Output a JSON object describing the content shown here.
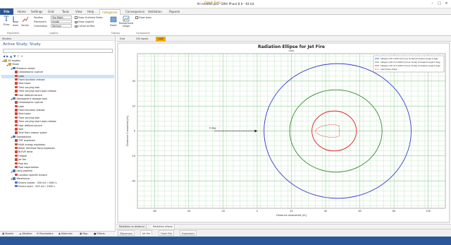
{
  "window": {
    "title": "All models.psu - DNV Phast 8.9 - 64 bit",
    "context_label": "Graph Tools"
  },
  "ribbon_tabs": [
    "File",
    "Home",
    "Settings",
    "Grid",
    "Tools",
    "View",
    "Help",
    "Categories",
    "Consequence",
    "Validation",
    "Reports"
  ],
  "ribbon": {
    "groups": [
      "Properties",
      "Legend",
      "Display",
      "Component"
    ],
    "buttons": {
      "titles": "Titles",
      "axes": "Axes",
      "series": "Series",
      "reset": "Reset",
      "background": "Background image",
      "component": "Show Axes"
    },
    "position_label": "Position",
    "position_value": "Top Right",
    "placement_label": "Placement",
    "placement_value": "Inside",
    "orientation_label": "Orientation",
    "orientation_value": "Vertical",
    "checks": [
      {
        "label": "Show Outlined Rates",
        "checked": false
      },
      {
        "label": "Show Legend",
        "checked": true
      },
      {
        "label": "Curtail at Max",
        "checked": true
      }
    ]
  },
  "left_pane": {
    "header": "Models",
    "study_title": "Active Study: Study",
    "search_placeholder": "",
    "tree": [
      {
        "label": "All models",
        "level": 0,
        "icon": "folder",
        "color": "#c9a646"
      },
      {
        "label": "Study",
        "level": 1,
        "icon": "folder",
        "color": "#c9a646"
      },
      {
        "label": "Pressure vessel",
        "level": 2,
        "icon": "vessel",
        "color": "#4a7bbf"
      },
      {
        "label": "Catastrophic rupture",
        "level": 3,
        "icon": "scenario",
        "color": "#d04a3a"
      },
      {
        "label": "Leak",
        "level": 3,
        "icon": "scenario",
        "color": "#d04a3a",
        "selected": true
      },
      {
        "label": "Fixed duration release",
        "level": 3,
        "icon": "scenario",
        "color": "#d04a3a"
      },
      {
        "label": "Short pipe",
        "level": 3,
        "icon": "scenario",
        "color": "#d04a3a"
      },
      {
        "label": "Time varying leak",
        "level": 3,
        "icon": "scenario",
        "color": "#d04a3a"
      },
      {
        "label": "Time varying short pipe release",
        "level": 3,
        "icon": "scenario",
        "color": "#d04a3a"
      },
      {
        "label": "User defined source",
        "level": 3,
        "icon": "scenario",
        "color": "#d04a3a"
      },
      {
        "label": "Atmospheric storage tank",
        "level": 2,
        "icon": "vessel",
        "color": "#4a7bbf"
      },
      {
        "label": "Catastrophic rupture",
        "level": 3,
        "icon": "scenario",
        "color": "#d04a3a"
      },
      {
        "label": "Leak",
        "level": 3,
        "icon": "scenario",
        "color": "#d04a3a"
      },
      {
        "label": "Fixed duration release",
        "level": 3,
        "icon": "scenario",
        "color": "#d04a3a"
      },
      {
        "label": "Short pipe",
        "level": 3,
        "icon": "scenario",
        "color": "#d04a3a"
      },
      {
        "label": "Time varying leak",
        "level": 3,
        "icon": "scenario",
        "color": "#d04a3a"
      },
      {
        "label": "Time varying short pipe release",
        "level": 3,
        "icon": "scenario",
        "color": "#d04a3a"
      },
      {
        "label": "User defined source",
        "level": 3,
        "icon": "scenario",
        "color": "#d04a3a"
      },
      {
        "label": "Spill",
        "level": 3,
        "icon": "scenario",
        "color": "#d04a3a"
      },
      {
        "label": "Tank from vapour space",
        "level": 3,
        "icon": "scenario",
        "color": "#d04a3a"
      },
      {
        "label": "Standalones",
        "level": 2,
        "icon": "vessel",
        "color": "#4a7bbf"
      },
      {
        "label": "TNT explosion",
        "level": 3,
        "icon": "scenario",
        "color": "#d04a3a"
      },
      {
        "label": "Multi energy explosion",
        "level": 3,
        "icon": "scenario",
        "color": "#d04a3a"
      },
      {
        "label": "Baker Strehlow Tang explosion",
        "level": 3,
        "icon": "scenario",
        "color": "#d04a3a"
      },
      {
        "label": "BLEVE blast",
        "level": 3,
        "icon": "scenario",
        "color": "#d04a3a"
      },
      {
        "label": "Fireball",
        "level": 3,
        "icon": "scenario",
        "color": "#d04a3a"
      },
      {
        "label": "Jet fire",
        "level": 3,
        "icon": "scenario",
        "color": "#d04a3a"
      },
      {
        "label": "Pool fire",
        "level": 3,
        "icon": "scenario",
        "color": "#d04a3a"
      },
      {
        "label": "Pool vaporization",
        "level": 3,
        "icon": "scenario",
        "color": "#d04a3a"
      },
      {
        "label": "Long pipeline",
        "level": 2,
        "icon": "vessel",
        "color": "#4a7bbf"
      },
      {
        "label": "Location specific breach",
        "level": 3,
        "icon": "scenario",
        "color": "#d04a3a"
      },
      {
        "label": "Warehouse",
        "level": 2,
        "icon": "vessel",
        "color": "#4a7bbf"
      },
      {
        "label": "Drums closed - 200 m2 / 1000 s",
        "level": 3,
        "icon": "scenario",
        "color": "#4a7bbf"
      },
      {
        "label": "Drums open - 200 m2 / 1000 s",
        "level": 3,
        "icon": "scenario",
        "color": "#4a7bbf"
      }
    ],
    "bottom_tabs": [
      "Models",
      "Weather",
      "Parameters",
      "Materials",
      "Map",
      "Effects"
    ]
  },
  "doc_tabs": [
    "Grid",
    "GIS Inputs",
    "Leak"
  ],
  "sub_tabs": [
    "Radiation vs distance",
    "Radiation ellipse"
  ],
  "result_tabs": [
    "Dispersion",
    "Jet fire",
    "Flash Fire",
    "Explosions"
  ],
  "chart_data": {
    "type": "line",
    "title": "Radiation Ellipse for Jet Fire",
    "subtitle": "Leak",
    "xlabel": "Distance downwind [m]",
    "ylabel": "Distance Crosswind [m]",
    "xlim": [
      -70,
      110
    ],
    "ylim": [
      -62,
      62
    ],
    "xticks": [
      -60,
      -40,
      -20,
      0,
      20,
      40,
      60,
      80,
      100
    ],
    "yticks": [
      -40,
      -20,
      0,
      20,
      40
    ],
    "grid": true,
    "legend_position": "top-right",
    "annotation": "0 deg",
    "series": [
      {
        "name": "Category 5/D 4.000 m2 [Cone model] [Crosswind angle 0 deg]",
        "color": "#3b3bcc",
        "shape": "ellipse",
        "cx": 47,
        "cy": 0,
        "rx": 43,
        "ry": 54
      },
      {
        "name": "Category 5/D 12.5 kW/m2 [Cone model] [Crosswind angle 0 deg]",
        "color": "#2e8b2e",
        "shape": "ellipse",
        "cx": 46,
        "cy": 0,
        "rx": 27,
        "ry": 33
      },
      {
        "name": "Category 5/D 37.5 kW/m2 [Cone model] [Crosswind angle 0 deg]",
        "color": "#dd2222",
        "shape": "ellipse",
        "cx": 45,
        "cy": 0,
        "rx": 13,
        "ry": 16
      },
      {
        "name": "Leak Flame shape",
        "color": "#dd2222",
        "shape": "flame",
        "x": [
          34,
          35,
          38,
          42,
          46,
          48,
          48,
          46,
          42,
          38,
          35,
          34
        ],
        "y": [
          0,
          2,
          4,
          5,
          5,
          4,
          -4,
          -5,
          -5,
          -4,
          -2,
          0
        ]
      }
    ]
  }
}
